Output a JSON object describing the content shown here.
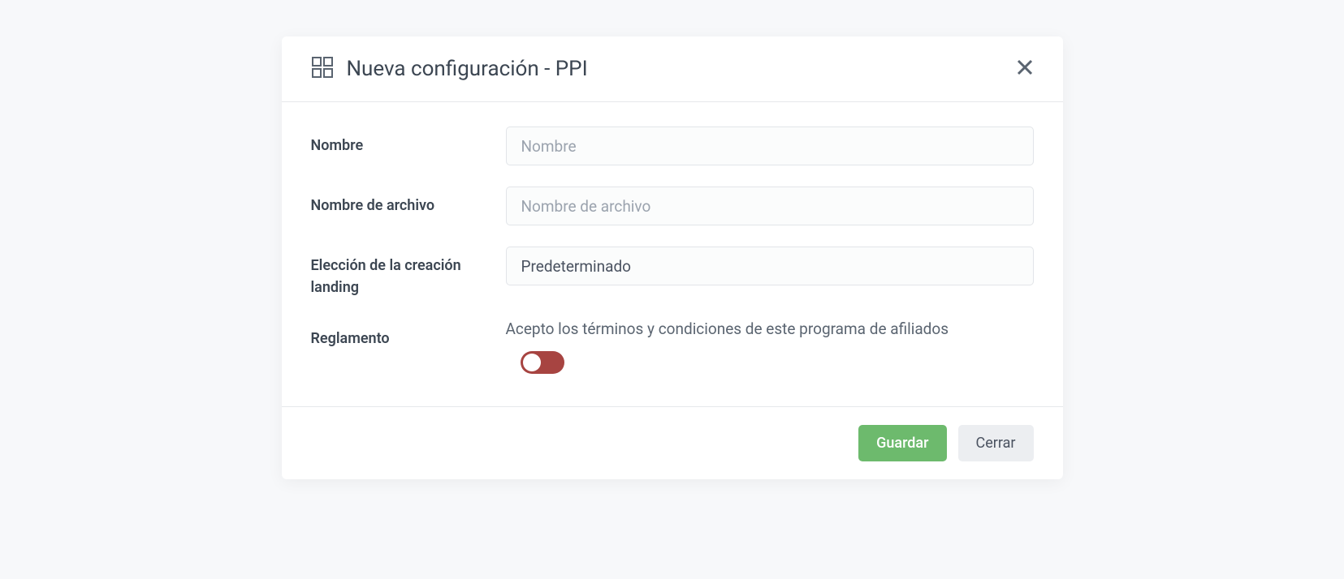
{
  "modal": {
    "title": "Nueva configuración - PPI",
    "fields": {
      "name": {
        "label": "Nombre",
        "placeholder": "Nombre",
        "value": ""
      },
      "filename": {
        "label": "Nombre de archivo",
        "placeholder": "Nombre de archivo",
        "value": ""
      },
      "landing": {
        "label": "Elección de la creación landing",
        "selected": "Predeterminado"
      },
      "regulation": {
        "label": "Reglamento",
        "terms_text": "Acepto los términos y condiciones de este programa de afiliados",
        "toggle_on": false
      }
    },
    "footer": {
      "save_label": "Guardar",
      "close_label": "Cerrar"
    }
  }
}
